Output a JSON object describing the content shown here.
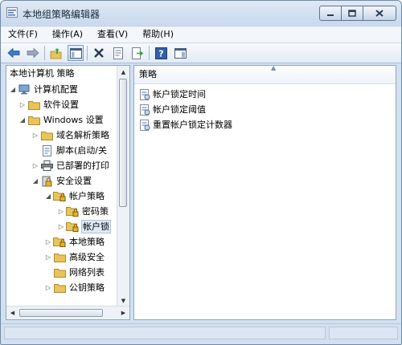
{
  "window": {
    "title": "本地组策略编辑器"
  },
  "menu": [
    "文件(F)",
    "操作(A)",
    "查看(V)",
    "帮助(H)"
  ],
  "toolbar": {
    "icons": [
      "back-icon",
      "forward-icon",
      "up-folder-icon",
      "show-hide-tree-icon",
      "delete-icon",
      "properties-icon",
      "export-icon",
      "help-icon",
      "panel-icon"
    ]
  },
  "tree": {
    "header": "本地计算机 策略",
    "items": [
      {
        "label": "计算机配置",
        "icon": "computer-icon"
      },
      {
        "label": "软件设置",
        "icon": "folder-icon"
      },
      {
        "label": "Windows 设置",
        "icon": "folder-icon"
      },
      {
        "label": "域名解析策略",
        "icon": "folder-icon"
      },
      {
        "label": "脚本(启动/关",
        "icon": "script-icon"
      },
      {
        "label": "已部署的打印",
        "icon": "printer-icon"
      },
      {
        "label": "安全设置",
        "icon": "security-icon"
      },
      {
        "label": "帐户策略",
        "icon": "folder-lock-icon"
      },
      {
        "label": "密码策",
        "icon": "folder-lock-icon"
      },
      {
        "label": "帐户锁",
        "icon": "folder-lock-icon"
      },
      {
        "label": "本地策略",
        "icon": "folder-lock-icon"
      },
      {
        "label": "高级安全",
        "icon": "folder-icon"
      },
      {
        "label": "网络列表",
        "icon": "folder-icon"
      },
      {
        "label": "公钥策略",
        "icon": "folder-icon"
      }
    ]
  },
  "list": {
    "column": "策略",
    "rows": [
      "帐户锁定时间",
      "帐户锁定阈值",
      "重置帐户锁定计数器"
    ]
  },
  "colors": {
    "folder": "#e8c45a",
    "selection": "#dfe9f6",
    "chrome": "#d3e0ef"
  }
}
